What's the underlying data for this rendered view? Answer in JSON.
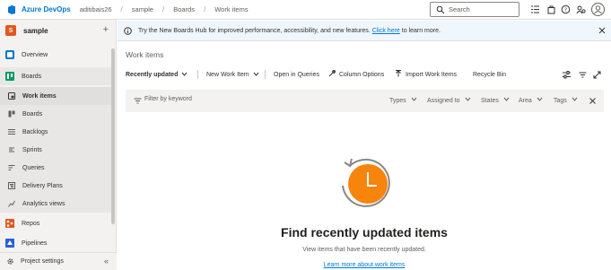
{
  "header": {
    "brand": "Azure DevOps",
    "breadcrumbs": [
      "aditibais26",
      "sample",
      "Boards",
      "Work items"
    ],
    "separator": "/",
    "search_placeholder": "Search"
  },
  "sidebar": {
    "project_initial": "S",
    "project_name": "sample",
    "add_label": "+",
    "items": [
      {
        "label": "Overview",
        "icon": "overview-icon"
      },
      {
        "label": "Boards",
        "icon": "boards-icon"
      },
      {
        "label": "Work items",
        "icon": "work-items-icon"
      },
      {
        "label": "Boards",
        "icon": "board-icon"
      },
      {
        "label": "Backlogs",
        "icon": "backlogs-icon"
      },
      {
        "label": "Sprints",
        "icon": "sprints-icon"
      },
      {
        "label": "Queries",
        "icon": "queries-icon"
      },
      {
        "label": "Delivery Plans",
        "icon": "delivery-plans-icon"
      },
      {
        "label": "Analytics views",
        "icon": "analytics-icon"
      },
      {
        "label": "Repos",
        "icon": "repos-icon"
      },
      {
        "label": "Pipelines",
        "icon": "pipelines-icon"
      }
    ],
    "footer_label": "Project settings",
    "collapse_glyph": "«"
  },
  "banner": {
    "text_before": "Try the New Boards Hub for improved performance, accessibility, and new features.",
    "link": "Click here",
    "text_after": "to learn more."
  },
  "main": {
    "title": "Work items",
    "toolbar": {
      "view_select": "Recently updated",
      "new_work_item": "New Work Item",
      "open_in_queries": "Open in Queries",
      "column_options": "Column Options",
      "import_work_items": "Import Work Items",
      "recycle_bin": "Recycle Bin"
    },
    "filter": {
      "placeholder": "Filter by keyword",
      "types": "Types",
      "assigned_to": "Assigned to",
      "states": "States",
      "area": "Area",
      "tags": "Tags"
    },
    "empty": {
      "title": "Find recently updated items",
      "subtitle": "View items that have been recently updated.",
      "link": "Learn more about work items"
    }
  },
  "colors": {
    "accent": "#0078d4",
    "clock": "#f7840c",
    "project_badge": "#e0581e"
  }
}
